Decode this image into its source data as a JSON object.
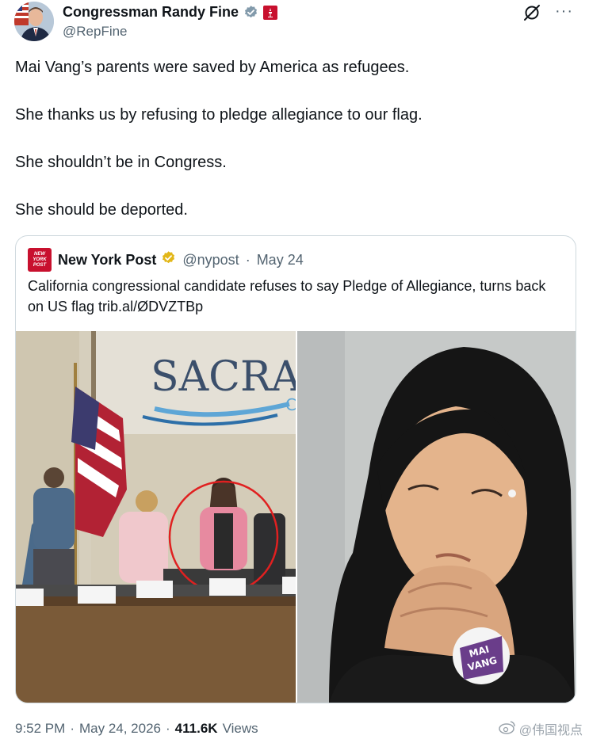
{
  "author": {
    "display_name": "Congressman Randy Fine",
    "handle": "@RepFine",
    "verified_icon": "verified-badge-icon",
    "affiliation_icon": "us-house-seal-icon"
  },
  "actions": {
    "grok_icon": "grok-icon",
    "more_label": "···"
  },
  "tweet": {
    "lines": [
      "Mai Vang’s parents were saved by America as refugees.",
      "She thanks us by refusing to pledge allegiance to our flag.",
      "She shouldn’t be in Congress.",
      "She should be deported."
    ]
  },
  "quote": {
    "logo_text_1": "NEW",
    "logo_text_2": "YORK",
    "logo_text_3": "POST",
    "display_name": "New York Post",
    "handle": "@nypost",
    "separator": "·",
    "date": "May 24",
    "text": "California congressional candidate refuses to say Pledge of Allegiance, turns back on US flag trib.al/ØDVZTBp",
    "left_image_sign": "SACRA",
    "left_image_sign_2": "C",
    "right_image_button_line1": "MAI",
    "right_image_button_line2": "VANG"
  },
  "footer": {
    "time": "9:52 PM",
    "dot1": "·",
    "date": "May 24, 2026",
    "dot2": "·",
    "views_count": "411.6K",
    "views_label": "Views"
  },
  "watermark": {
    "text": "@伟国视点",
    "icon": "weibo-icon"
  },
  "colors": {
    "text": "#0f1419",
    "secondary": "#536471",
    "border": "#cfd9de",
    "verified_blue": "#1d9bf0",
    "gold": "#e2b719",
    "nypost_red": "#c8102e"
  }
}
